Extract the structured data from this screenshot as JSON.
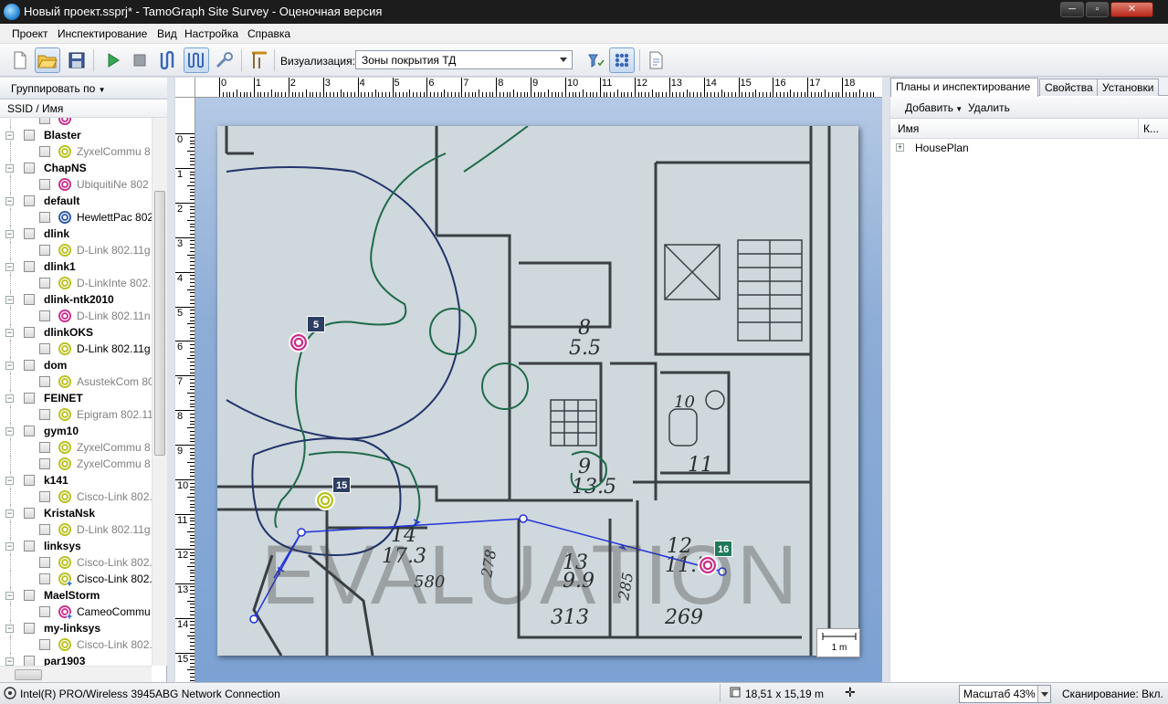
{
  "window": {
    "title": "Новый проект.ssprj* - TamoGraph Site Survey - Оценочная версия",
    "minimize": "─",
    "maximize": "▫",
    "close": "✕"
  },
  "menu": [
    "Проект",
    "Инспектирование",
    "Вид",
    "Настройка",
    "Справка"
  ],
  "toolbar": {
    "visualization_label": "Визуализация:",
    "visualization_value": "Зоны покрытия ТД",
    "icons": [
      "new-icon",
      "open-icon",
      "save-icon",
      "play-icon",
      "stop-icon",
      "survey-mode-icon",
      "passive-survey-icon",
      "settings-icon",
      "route-icon",
      "filter-icon",
      "grid-icon",
      "report-icon"
    ]
  },
  "left": {
    "group_by": "Группировать по",
    "column": "SSID / Имя",
    "rows": [
      {
        "type": "ap",
        "icon": "pink",
        "label": ""
      },
      {
        "type": "grp",
        "label": "Blaster"
      },
      {
        "type": "ap",
        "icon": "yellow",
        "label": "ZyxelCommu 8",
        "dim": true
      },
      {
        "type": "grp",
        "label": "ChapNS"
      },
      {
        "type": "ap",
        "icon": "pink",
        "label": "UbiquitiNe 802",
        "dim": true
      },
      {
        "type": "grp",
        "label": "default"
      },
      {
        "type": "ap",
        "icon": "blue",
        "label": "HewlettPac 802",
        "dim": false
      },
      {
        "type": "grp",
        "label": "dlink"
      },
      {
        "type": "ap",
        "icon": "yellow",
        "label": "D-Link 802.11g",
        "dim": true
      },
      {
        "type": "grp",
        "label": "dlink1"
      },
      {
        "type": "ap",
        "icon": "yellow",
        "label": "D-LinkInte 802.",
        "dim": true
      },
      {
        "type": "grp",
        "label": "dlink-ntk2010"
      },
      {
        "type": "ap",
        "icon": "pink",
        "label": "D-Link 802.11n",
        "dim": true
      },
      {
        "type": "grp",
        "label": "dlinkOKS"
      },
      {
        "type": "ap",
        "icon": "yellow",
        "label": "D-Link 802.11g",
        "dim": false
      },
      {
        "type": "grp",
        "label": "dom"
      },
      {
        "type": "ap",
        "icon": "yellow",
        "label": "AsustekCom 80",
        "dim": true
      },
      {
        "type": "grp",
        "label": "FEINET"
      },
      {
        "type": "ap",
        "icon": "yellow",
        "label": "Epigram 802.11",
        "dim": true
      },
      {
        "type": "grp",
        "label": "gym10"
      },
      {
        "type": "ap",
        "icon": "yellow",
        "label": "ZyxelCommu 8",
        "dim": true
      },
      {
        "type": "ap",
        "icon": "yellow",
        "label": "ZyxelCommu 8",
        "dim": true
      },
      {
        "type": "grp",
        "label": "k141"
      },
      {
        "type": "ap",
        "icon": "yellow",
        "label": "Cisco-Link 802.",
        "dim": true
      },
      {
        "type": "grp",
        "label": "KristaNsk"
      },
      {
        "type": "ap",
        "icon": "yellow",
        "label": "D-Link 802.11g",
        "dim": true
      },
      {
        "type": "grp",
        "label": "linksys"
      },
      {
        "type": "ap",
        "icon": "yellow",
        "label": "Cisco-Link 802.",
        "dim": true
      },
      {
        "type": "ap",
        "icon": "yellow-plus",
        "label": "Cisco-Link 802.",
        "dim": false
      },
      {
        "type": "grp",
        "label": "MaelStorm"
      },
      {
        "type": "ap",
        "icon": "pink-plus",
        "label": "CameoCommu",
        "dim": false
      },
      {
        "type": "grp",
        "label": "my-linksys"
      },
      {
        "type": "ap",
        "icon": "yellow",
        "label": "Cisco-Link 802.",
        "dim": true
      },
      {
        "type": "grp",
        "label": "par1903"
      }
    ]
  },
  "ruler": {
    "top": [
      "0",
      "1",
      "2",
      "3",
      "4",
      "5",
      "6",
      "7",
      "8",
      "9",
      "10",
      "11",
      "12",
      "13",
      "14",
      "15",
      "16",
      "17",
      "18"
    ],
    "left": [
      "0",
      "1",
      "2",
      "3",
      "4",
      "5",
      "6",
      "7",
      "8",
      "9",
      "10",
      "11",
      "12",
      "13",
      "14",
      "15"
    ]
  },
  "map": {
    "watermark": "EVALUATION",
    "scale_label": "1 m",
    "rooms": [
      {
        "label": "8",
        "sub": "5.5"
      },
      {
        "label": "12",
        "sub": "11.7"
      },
      {
        "label": "10",
        "sub": ""
      },
      {
        "label": "11",
        "sub": ""
      },
      {
        "label": "9",
        "sub": "13.5"
      },
      {
        "label": "14",
        "sub": "17.3"
      },
      {
        "label": "13",
        "sub": "9.9"
      }
    ],
    "dims": [
      "278",
      "285",
      "313",
      "269",
      "580"
    ],
    "access_points": [
      {
        "id": "5",
        "color": "#cc2e8a",
        "badge": "#2d3e63"
      },
      {
        "id": "15",
        "color": "#b8c21c",
        "badge": "#2d3e63"
      },
      {
        "id": "16",
        "color": "#cc2e8a",
        "badge": "#1f7a5c"
      }
    ]
  },
  "right": {
    "tabs": [
      "Планы и инспектирование",
      "Свойства",
      "Установки"
    ],
    "add": "Добавить",
    "delete": "Удалить",
    "col_name": "Имя",
    "col_k": "К...",
    "plan_item": "HousePlan"
  },
  "status": {
    "adapter": "Intel(R) PRO/Wireless 3945ABG Network Connection",
    "coords": "18,51 x 15,19 m",
    "zoom": "Масштаб 43%",
    "scanning": "Сканирование: Вкл."
  }
}
